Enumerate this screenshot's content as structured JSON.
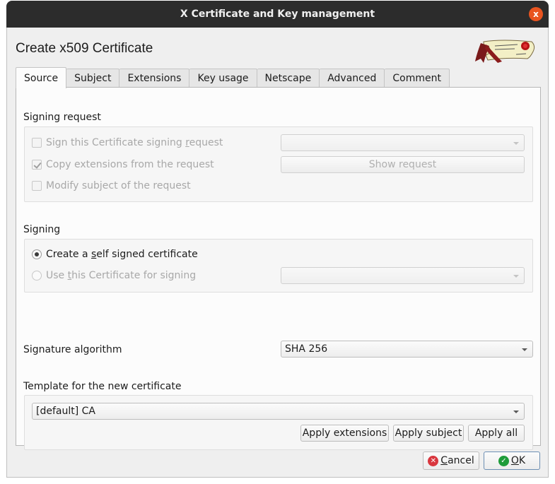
{
  "window": {
    "title": "X Certificate and Key management",
    "close_glyph": "x"
  },
  "dialog": {
    "title": "Create x509 Certificate",
    "logo_icon": "certificate-scroll-icon"
  },
  "tabs": [
    {
      "label": "Source",
      "active": true
    },
    {
      "label": "Subject"
    },
    {
      "label": "Extensions"
    },
    {
      "label": "Key usage"
    },
    {
      "label": "Netscape"
    },
    {
      "label": "Advanced"
    },
    {
      "label": "Comment"
    }
  ],
  "signing_request": {
    "label": "Signing request",
    "sign_csr": {
      "pre": "Sign this Certificate signing ",
      "mnemonic": "r",
      "post": "equest",
      "checked": false,
      "enabled": false
    },
    "copy_ext": {
      "label": "Copy extensions from the request",
      "checked": true,
      "enabled": false
    },
    "modify_subject": {
      "label": "Modify subject of the request",
      "checked": false,
      "enabled": false
    },
    "request_combo_value": "",
    "show_request_label": "Show request"
  },
  "signing": {
    "label": "Signing",
    "self_signed": {
      "pre": "Create a ",
      "mnemonic": "s",
      "post": "elf signed certificate",
      "selected": true
    },
    "use_cert": {
      "pre": "Use ",
      "mnemonic": "t",
      "post": "his Certificate for signing",
      "selected": false,
      "enabled": false
    },
    "cert_combo_value": ""
  },
  "signature_algorithm": {
    "label": "Signature algorithm",
    "value": "SHA 256"
  },
  "template": {
    "label": "Template for the new certificate",
    "value": "[default] CA",
    "apply_extensions": "Apply extensions",
    "apply_subject": "Apply subject",
    "apply_all": "Apply all"
  },
  "buttons": {
    "cancel": {
      "mnemonic": "C",
      "rest": "ancel",
      "icon": "cancel-icon",
      "color": "#d9363e"
    },
    "ok": {
      "mnemonic": "O",
      "rest": "K",
      "icon": "ok-icon",
      "color": "#1e9c3a"
    }
  }
}
